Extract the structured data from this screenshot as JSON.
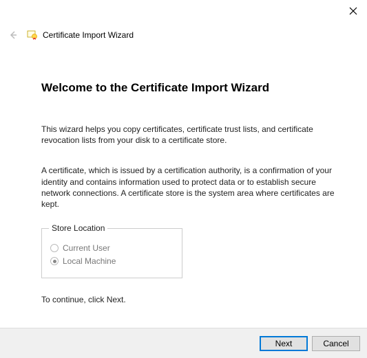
{
  "window": {
    "title": "Certificate Import Wizard"
  },
  "content": {
    "heading": "Welcome to the Certificate Import Wizard",
    "para1": "This wizard helps you copy certificates, certificate trust lists, and certificate revocation lists from your disk to a certificate store.",
    "para2": "A certificate, which is issued by a certification authority, is a confirmation of your identity and contains information used to protect data or to establish secure network connections. A certificate store is the system area where certificates are kept.",
    "storeLocation": {
      "legend": "Store Location",
      "options": [
        {
          "label": "Current User",
          "selected": false
        },
        {
          "label": "Local Machine",
          "selected": true
        }
      ]
    },
    "continueText": "To continue, click Next."
  },
  "footer": {
    "next": "Next",
    "cancel": "Cancel"
  }
}
